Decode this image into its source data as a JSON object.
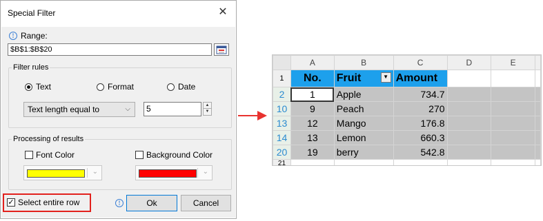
{
  "dialog": {
    "title": "Special Filter",
    "close_glyph": "✕",
    "range_label": "Range:",
    "range_value": "$B$1:$B$20",
    "filter_rules": {
      "legend": "Filter rules",
      "options": [
        "Text",
        "Format",
        "Date"
      ],
      "selected": "Text",
      "condition": "Text length equal to",
      "value": "5"
    },
    "processing": {
      "legend": "Processing of results",
      "font_color_label": "Font Color",
      "font_color": "#ffff00",
      "background_color_label": "Background Color",
      "background_color": "#ff0000"
    },
    "select_entire_row_label": "Select entire row",
    "select_entire_row_checked": true,
    "ok_label": "Ok",
    "cancel_label": "Cancel"
  },
  "spreadsheet": {
    "columns": [
      "A",
      "B",
      "C",
      "D",
      "E"
    ],
    "header_row_num": "1",
    "headers": [
      "No.",
      "Fruit",
      "Amount"
    ],
    "rows": [
      {
        "row": "2",
        "no": "1",
        "fruit": "Apple",
        "amount": "734.7"
      },
      {
        "row": "10",
        "no": "9",
        "fruit": "Peach",
        "amount": "270"
      },
      {
        "row": "13",
        "no": "12",
        "fruit": "Mango",
        "amount": "176.8"
      },
      {
        "row": "14",
        "no": "13",
        "fruit": "Lemon",
        "amount": "660.3"
      },
      {
        "row": "20",
        "no": "19",
        "fruit": "berry",
        "amount": "542.8"
      }
    ],
    "last_row_num": "21",
    "header_fill": "#1da0ec",
    "selection_fill": "#c4c4c4"
  }
}
